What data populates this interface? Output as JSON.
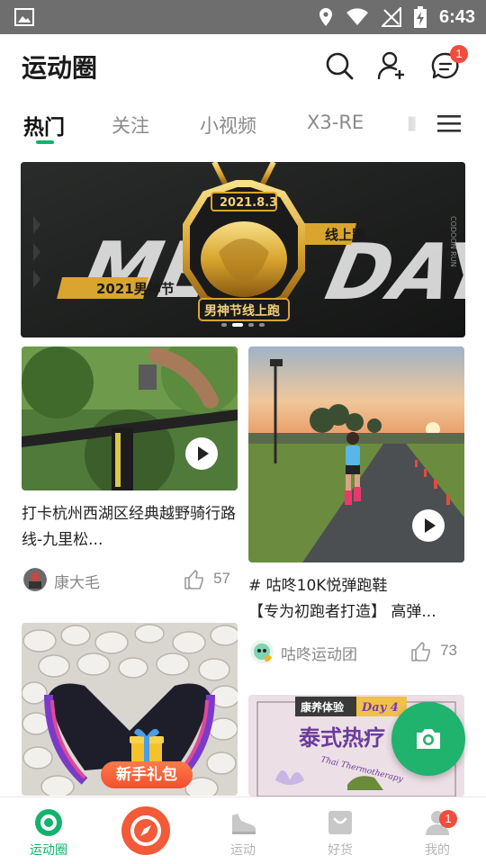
{
  "status_bar": {
    "time": "6:43"
  },
  "header": {
    "title": "运动圈",
    "message_badge": "1"
  },
  "tabs": [
    {
      "label": "热门",
      "active": true
    },
    {
      "label": "关注",
      "active": false
    },
    {
      "label": "小视频",
      "active": false
    },
    {
      "label": "X3-RE",
      "active": false
    }
  ],
  "banner": {
    "slide_index": 2,
    "slide_count": 4,
    "artwork_text": {
      "date": "2021.8.3",
      "left_word": "MEN",
      "right_word": "DAY",
      "left_tag": "2021男神节",
      "right_tag": "线上跑",
      "center_tag": "男神节线上跑",
      "side_text": "CODOON RUN"
    }
  },
  "feed": {
    "left": [
      {
        "title": "打卡杭州西湖区经典越野骑行路线-九里松...",
        "author": "康大毛",
        "likes": "57",
        "is_video": true
      },
      {
        "title": "",
        "is_video": false
      }
    ],
    "right": [
      {
        "title_line1": "# 咕咚10K悦弹跑鞋",
        "title_line2": "【专为初跑者打造】 高弹...",
        "author": "咕咚运动团",
        "likes": "73",
        "is_video": true
      },
      {
        "title": "",
        "is_video": false,
        "artwork_text": {
          "tag": "康养体验",
          "day": "Day 4",
          "headline": "泰式热疗",
          "subtitle": "Thai Thermotherapy"
        }
      }
    ]
  },
  "gift": {
    "label": "新手礼包"
  },
  "fab": {
    "icon": "camera-icon"
  },
  "bottom_nav": [
    {
      "label": "运动圈",
      "active": true
    },
    {
      "label": "",
      "active": false
    },
    {
      "label": "运动",
      "active": false
    },
    {
      "label": "好货",
      "active": false
    },
    {
      "label": "我的",
      "active": false,
      "badge": "1"
    }
  ],
  "colors": {
    "accent": "#12b36c",
    "fab": "#1fb36d",
    "badge": "#f24c3d",
    "compass": "#f25a3a",
    "status_bar": "#6e6e6e"
  }
}
